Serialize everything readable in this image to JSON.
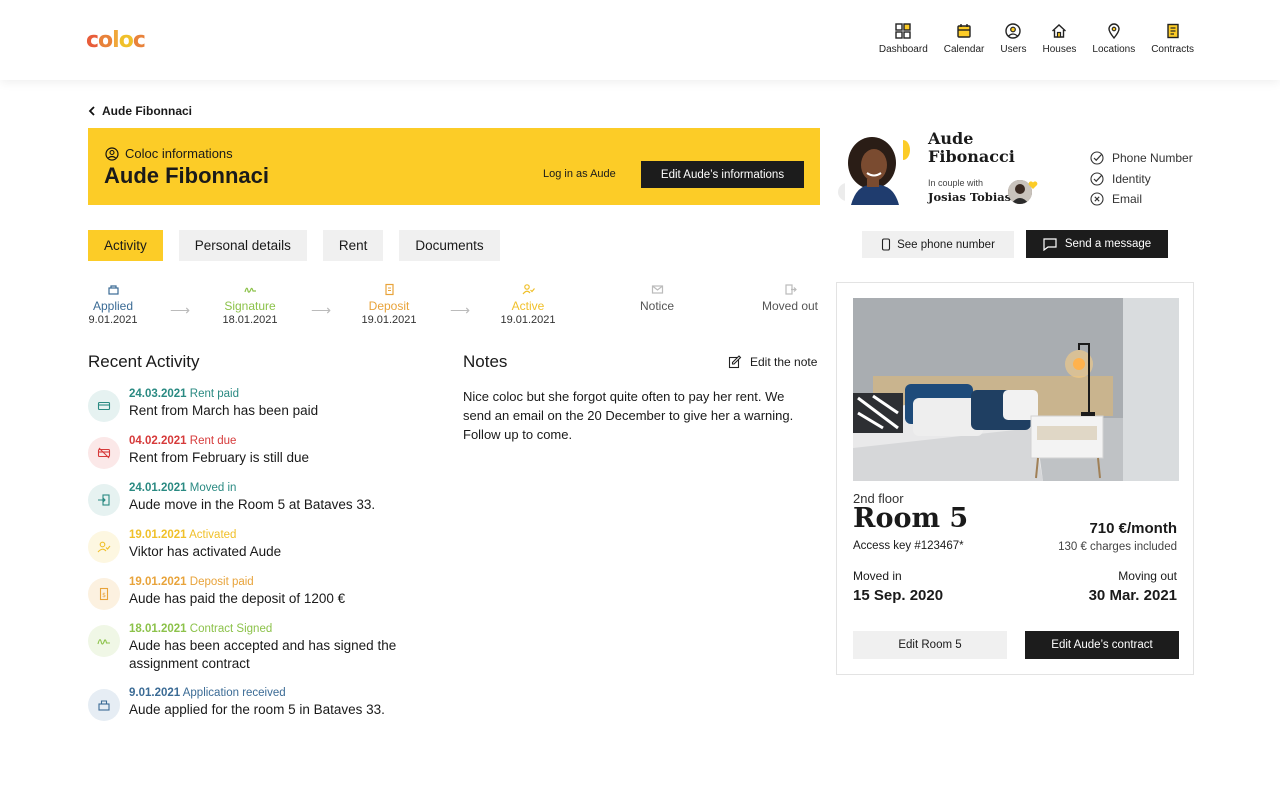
{
  "brand": {
    "logo_text": "coloc",
    "accent": "#fccc27"
  },
  "nav": [
    {
      "label": "Dashboard",
      "icon": "grid-icon"
    },
    {
      "label": "Calendar",
      "icon": "calendar-icon"
    },
    {
      "label": "Users",
      "icon": "user-icon"
    },
    {
      "label": "Houses",
      "icon": "house-icon"
    },
    {
      "label": "Locations",
      "icon": "map-pin-icon"
    },
    {
      "label": "Contracts",
      "icon": "document-icon"
    }
  ],
  "breadcrumb": {
    "back_label": "Aude Fibonnaci"
  },
  "banner": {
    "subtitle": "Coloc informations",
    "name": "Aude Fibonnaci",
    "login_label": "Log in as Aude",
    "edit_label": "Edit Aude’s informations"
  },
  "tabs": [
    "Activity",
    "Personal details",
    "Rent",
    "Documents"
  ],
  "active_tab": "Activity",
  "steps": [
    {
      "label": "Applied",
      "date": "9.01.2021",
      "color": "#3b6b95"
    },
    {
      "label": "Signature",
      "date": "18.01.2021",
      "color": "#8cc24a"
    },
    {
      "label": "Deposit",
      "date": "19.01.2021",
      "color": "#e8a33a"
    },
    {
      "label": "Active",
      "date": "19.01.2021",
      "color": "#f0c02a"
    },
    {
      "label": "Notice",
      "date": "",
      "color": "#555555"
    },
    {
      "label": "Moved out",
      "date": "",
      "color": "#555555"
    }
  ],
  "recent_activity": {
    "title": "Recent Activity",
    "items": [
      {
        "date": "24.03.2021",
        "status": "Rent paid",
        "text": "Rent from March has been paid",
        "color": "#2a8a82",
        "bg": "#e6f2f1"
      },
      {
        "date": "04.02.2021",
        "status": "Rent due",
        "text": "Rent from February is still due",
        "color": "#d63a3a",
        "bg": "#fbe8e8"
      },
      {
        "date": "24.01.2021",
        "status": "Moved in",
        "text": "Aude move in the Room 5 at Bataves 33.",
        "color": "#2a8a82",
        "bg": "#e6f2f1"
      },
      {
        "date": "19.01.2021",
        "status": "Activated",
        "text": "Viktor has activated Aude",
        "color": "#f0c02a",
        "bg": "#fdf7e1"
      },
      {
        "date": "19.01.2021",
        "status": "Deposit paid",
        "text": "Aude has paid the deposit of 1200 €",
        "color": "#e8a33a",
        "bg": "#fcf1e0"
      },
      {
        "date": "18.01.2021",
        "status": "Contract Signed",
        "text": "Aude has been accepted and has signed the assignment contract",
        "color": "#8cc24a",
        "bg": "#f0f7e6"
      },
      {
        "date": "9.01.2021",
        "status": "Application received",
        "text": "Aude applied for the room 5 in Bataves 33.",
        "color": "#3b6b95",
        "bg": "#e6edf4"
      }
    ]
  },
  "notes": {
    "title": "Notes",
    "edit_label": "Edit the note",
    "text": "Nice coloc but she forgot quite often to pay her rent. We send an email on the 20 December to give her a warning. Follow up to come."
  },
  "profile": {
    "first_name": "Aude",
    "last_name": "Fibonacci",
    "couple_label": "In couple with",
    "partner_name": "Josias Tobias",
    "checks": [
      {
        "label": "Phone Number",
        "status": "check"
      },
      {
        "label": "Identity",
        "status": "check"
      },
      {
        "label": "Email",
        "status": "cross"
      }
    ],
    "see_phone_label": "See phone number",
    "send_message_label": "Send a message"
  },
  "room": {
    "floor": "2nd floor",
    "name": "Room 5",
    "access_key": "Access key #123467*",
    "price": "710 €/month",
    "charges": "130 € charges included",
    "moved_in_label": "Moved in",
    "moved_in": "15 Sep. 2020",
    "moving_out_label": "Moving out",
    "moving_out": "30 Mar. 2021",
    "edit_room_label": "Edit Room 5",
    "edit_contract_label": "Edit Aude’s contract"
  }
}
